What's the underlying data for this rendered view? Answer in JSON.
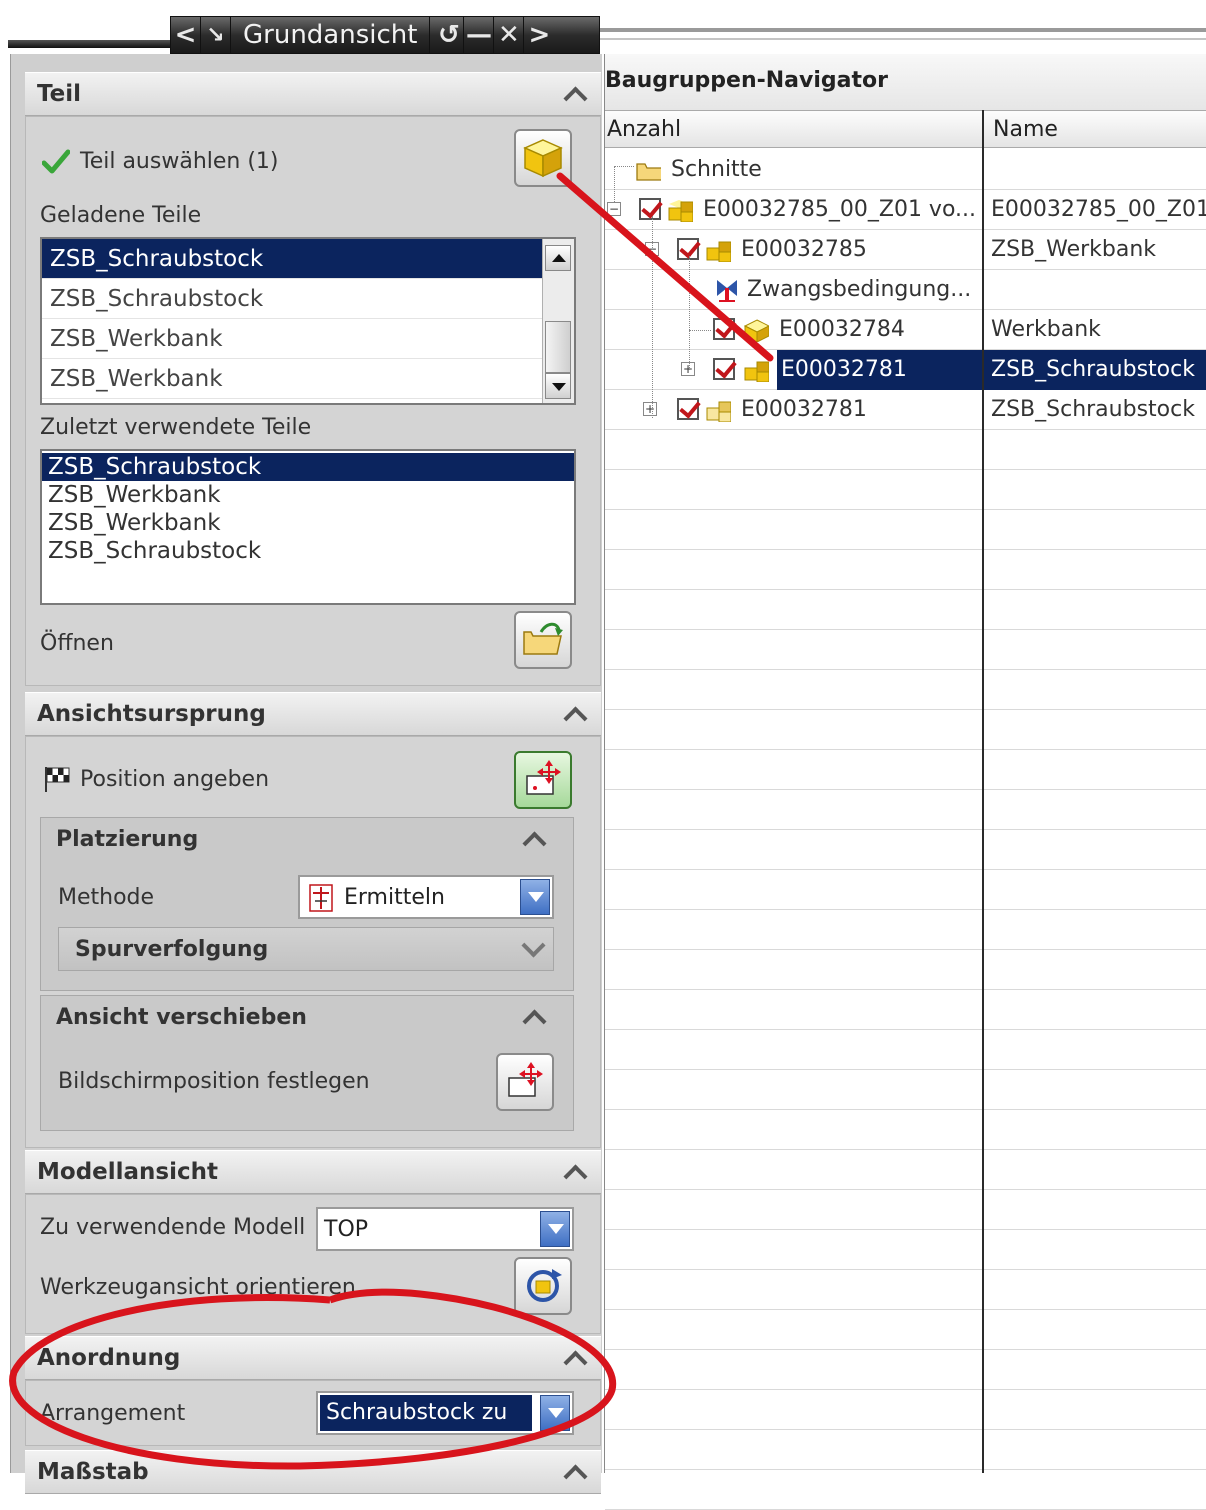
{
  "titlebar": {
    "title": "Grundansicht",
    "buttons": [
      "<",
      "↘",
      "↺",
      "—",
      "✕",
      ">"
    ]
  },
  "teil": {
    "header": "Teil",
    "select_label": "Teil auswählen (1)",
    "loaded_label": "Geladene Teile",
    "loaded_parts": [
      "ZSB_Schraubstock",
      "ZSB_Schraubstock",
      "ZSB_Werkbank",
      "ZSB_Werkbank"
    ],
    "recent_label": "Zuletzt verwendete Teile",
    "recent_parts": [
      "ZSB_Schraubstock",
      "ZSB_Werkbank",
      "ZSB_Werkbank",
      "ZSB_Schraubstock"
    ],
    "open_label": "Öffnen"
  },
  "ursprung": {
    "header": "Ansichtsursprung",
    "position_label": "Position angeben",
    "platzierung": {
      "header": "Platzierung",
      "methode_label": "Methode",
      "methode_value": "Ermitteln",
      "spur_header": "Spurverfolgung"
    },
    "verschieben": {
      "header": "Ansicht verschieben",
      "screen_label": "Bildschirmposition festlegen"
    }
  },
  "modell": {
    "header": "Modellansicht",
    "model_label": "Zu verwendende Modell",
    "model_value": "TOP",
    "orient_label": "Werkzeugansicht orientieren"
  },
  "anordnung": {
    "header": "Anordnung",
    "arrangement_label": "Arrangement",
    "arrangement_value": "Schraubstock zu"
  },
  "massstab": {
    "header": "Maßstab"
  },
  "navigator": {
    "title": "Baugruppen-Navigator",
    "columns": [
      "Anzahl",
      "Name"
    ],
    "rows": [
      {
        "text": "Schnitte",
        "name": ""
      },
      {
        "text": "E00032785_00_Z01 vo...",
        "name": "E00032785_00_Z01"
      },
      {
        "text": "E00032785",
        "name": "ZSB_Werkbank"
      },
      {
        "text": "Zwangsbedingung...",
        "name": ""
      },
      {
        "text": "E00032784",
        "name": "Werkbank"
      },
      {
        "text": "E00032781",
        "name": "ZSB_Schraubstock"
      },
      {
        "text": "E00032781",
        "name": "ZSB_Schraubstock"
      }
    ]
  },
  "colors": {
    "selection": "#0b245e",
    "annotation": "#d8141c",
    "panel": "#d4d4d4"
  }
}
